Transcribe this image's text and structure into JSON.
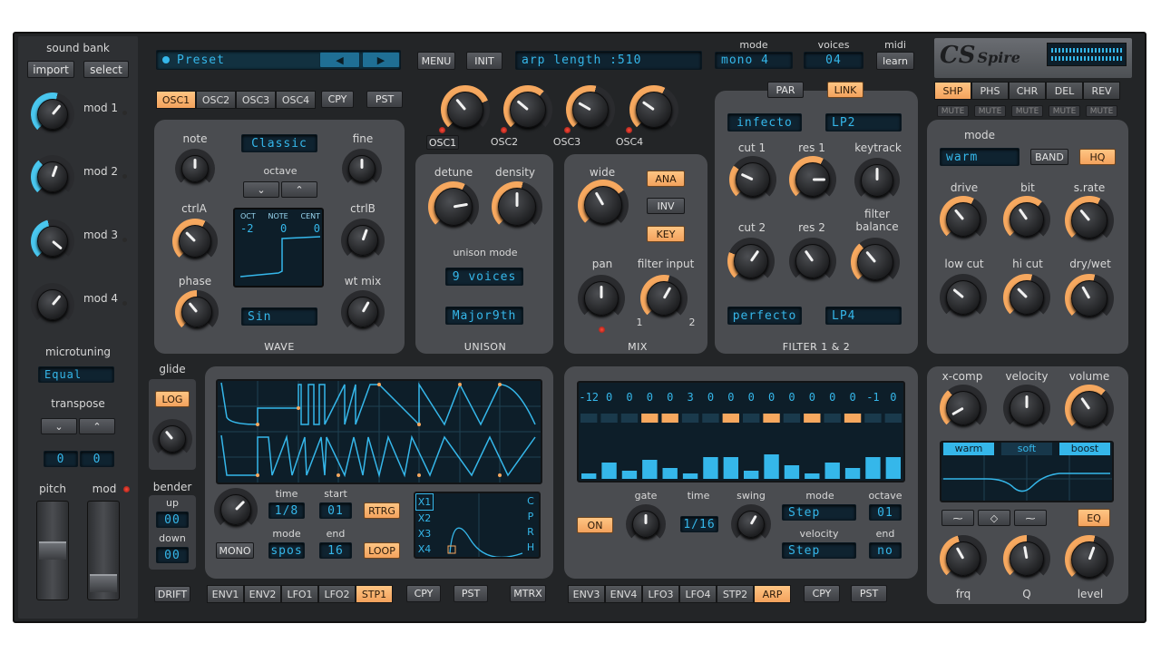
{
  "colors": {
    "accent": "#f6a85f",
    "lcd_text": "#35b7ea",
    "knob_ring_orange": "#f6a85f",
    "knob_ring_blue": "#49c6ee",
    "panel": "#4a4c50"
  },
  "left": {
    "sound_bank": "sound bank",
    "import": "import",
    "select": "select",
    "mods": [
      "mod 1",
      "mod 2",
      "mod 3",
      "mod 4"
    ],
    "microtuning": "microtuning",
    "microtuning_value": "Equal",
    "transpose": "transpose",
    "transpose_octave": "0",
    "transpose_semi": "0",
    "pitch": "pitch",
    "mod": "mod"
  },
  "top": {
    "preset": "Preset",
    "menu": "MENU",
    "init": "INIT",
    "display": "arp length   :510",
    "mode_label": "mode",
    "mode_value": "mono 4",
    "voices_label": "voices",
    "voices_value": "04",
    "midi_label": "midi",
    "learn": "learn",
    "logo": "Spire"
  },
  "osc": {
    "tabs": [
      "OSC1",
      "OSC2",
      "OSC3",
      "OSC4"
    ],
    "cpy": "CPY",
    "pst": "PST",
    "knob_labels": [
      "OSC1",
      "OSC2",
      "OSC3",
      "OSC4"
    ],
    "note": "note",
    "fine": "fine",
    "ctrlA": "ctrlA",
    "ctrlB": "ctrlB",
    "phase": "phase",
    "wt_mix": "wt mix",
    "octave": "octave",
    "type": "Classic",
    "wave_display": {
      "oct_label": "OCT",
      "note_label": "NOTE",
      "cent_label": "CENT",
      "oct": "-2",
      "note": "0",
      "cent": "0"
    },
    "wave": "Sin",
    "wave_title": "WAVE"
  },
  "unison": {
    "detune": "detune",
    "density": "density",
    "mode_label": "unison mode",
    "mode": "9 voices",
    "chord": "Major9th",
    "title": "UNISON"
  },
  "mix": {
    "wide": "wide",
    "ana": "ANA",
    "inv": "INV",
    "key": "KEY",
    "pan": "pan",
    "filter_input": "filter input",
    "in1": "1",
    "in2": "2",
    "title": "MIX"
  },
  "filter": {
    "par": "PAR",
    "link": "LINK",
    "type1": "infecto",
    "mode1": "LP2",
    "cut1": "cut 1",
    "res1": "res 1",
    "keytrack": "keytrack",
    "cut2": "cut 2",
    "res2": "res 2",
    "balance": "filter\nbalance",
    "type2": "perfecto",
    "mode2": "LP4",
    "title": "FILTER 1 & 2"
  },
  "fx": {
    "tabs": [
      "SHP",
      "PHS",
      "CHR",
      "DEL",
      "REV"
    ],
    "mute": "MUTE",
    "mode_label": "mode",
    "mode": "warm",
    "band": "BAND",
    "hq": "HQ",
    "drive": "drive",
    "bit": "bit",
    "srate": "s.rate",
    "low_cut": "low cut",
    "hi_cut": "hi cut",
    "dry_wet": "dry/wet"
  },
  "eq": {
    "xcomp": "x-comp",
    "velocity": "velocity",
    "volume": "volume",
    "presets": [
      "warm",
      "soft",
      "boost"
    ],
    "eq": "EQ",
    "frq": "frq",
    "q": "Q",
    "level": "level"
  },
  "env": {
    "glide": "glide",
    "log": "LOG",
    "bender": "bender",
    "up_label": "up",
    "up": "00",
    "down_label": "down",
    "down": "00",
    "time_label": "time",
    "time": "1/8",
    "start_label": "start",
    "start": "01",
    "rtrg": "RTRG",
    "mode_label": "mode",
    "mode": "spos",
    "end_label": "end",
    "end": "16",
    "loop": "LOOP",
    "mono": "MONO",
    "x_rows": [
      "X1",
      "X2",
      "X3",
      "X4"
    ],
    "cprh": [
      "C",
      "P",
      "R",
      "H"
    ],
    "drift": "DRIFT",
    "tabs": [
      "ENV1",
      "ENV2",
      "LFO1",
      "LFO2",
      "STP1"
    ],
    "cpy": "CPY",
    "pst": "PST",
    "mtrx": "MTRX"
  },
  "arp": {
    "values": [
      "-12",
      "0",
      "0",
      "0",
      "0",
      "3",
      "0",
      "0",
      "0",
      "0",
      "0",
      "0",
      "0",
      "0",
      "-1",
      "0"
    ],
    "bars": [
      0.1,
      0.3,
      0.15,
      0.35,
      0.2,
      0.1,
      0.4,
      0.4,
      0.15,
      0.45,
      0.25,
      0.1,
      0.3,
      0.2,
      0.4,
      0.4
    ],
    "arrows": [
      0,
      0,
      0,
      1,
      1,
      0,
      0,
      1,
      0,
      1,
      0,
      1,
      0,
      1,
      0,
      0
    ],
    "gate": "gate",
    "time_label": "time",
    "time": "1/16",
    "swing": "swing",
    "mode_label": "mode",
    "mode": "Step",
    "octave_label": "octave",
    "octave": "01",
    "on": "ON",
    "velocity_label": "velocity",
    "velocity": "Step",
    "end_label": "end",
    "end": "no",
    "tabs": [
      "ENV3",
      "ENV4",
      "LFO3",
      "LFO4",
      "STP2",
      "ARP"
    ],
    "cpy": "CPY",
    "pst": "PST"
  }
}
